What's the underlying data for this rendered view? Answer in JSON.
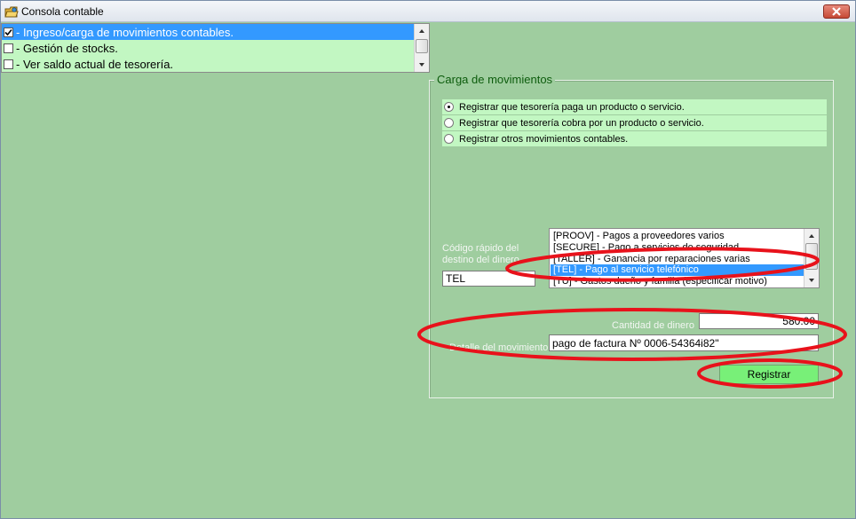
{
  "window": {
    "title": "Consola contable",
    "icon": "app-folder-icon",
    "close_icon": "close-icon"
  },
  "checklist": {
    "items": [
      {
        "label": "- Ingreso/carga de movimientos contables.",
        "checked": true,
        "selected": true
      },
      {
        "label": "- Gestión de stocks.",
        "checked": false,
        "selected": false
      },
      {
        "label": "- Ver saldo actual de tesorería.",
        "checked": false,
        "selected": false
      }
    ]
  },
  "movimientos": {
    "group_title": "Carga de movimientos",
    "options": [
      {
        "label": "Registrar que tesorería paga un producto o servicio.",
        "selected": true
      },
      {
        "label": "Registrar que tesorería cobra por un producto o servicio.",
        "selected": false
      },
      {
        "label": "Registrar otros movimientos contables.",
        "selected": false
      }
    ],
    "codigo_label_1": "Código rápido del",
    "codigo_label_2": "destino del dinero",
    "codigo_value": "TEL",
    "destinos": [
      {
        "label": "[PROOV] - Pagos a proveedores varios",
        "selected": false
      },
      {
        "label": "[SECURE] - Pago a servicios de seguridad",
        "selected": false
      },
      {
        "label": "[TALLER] - Ganancia por reparaciones varias",
        "selected": false
      },
      {
        "label": "[TEL] - Pago al servicio telefónico",
        "selected": true
      },
      {
        "label": "[TU] - Gastos dueño y familia (especificar motivo)",
        "selected": false
      }
    ],
    "cantidad_label": "Cantidad de dinero",
    "cantidad_value": "580.00",
    "detalle_label": "Detalle del movimiento",
    "detalle_value": "pago de factura Nº 0006-54364i82\"",
    "registrar_label": "Registrar"
  },
  "colors": {
    "background": "#9fcd9f",
    "row_background": "#c2f7c2",
    "selection": "#3399ff",
    "button": "#78f078",
    "annotation": "#e8121b"
  }
}
